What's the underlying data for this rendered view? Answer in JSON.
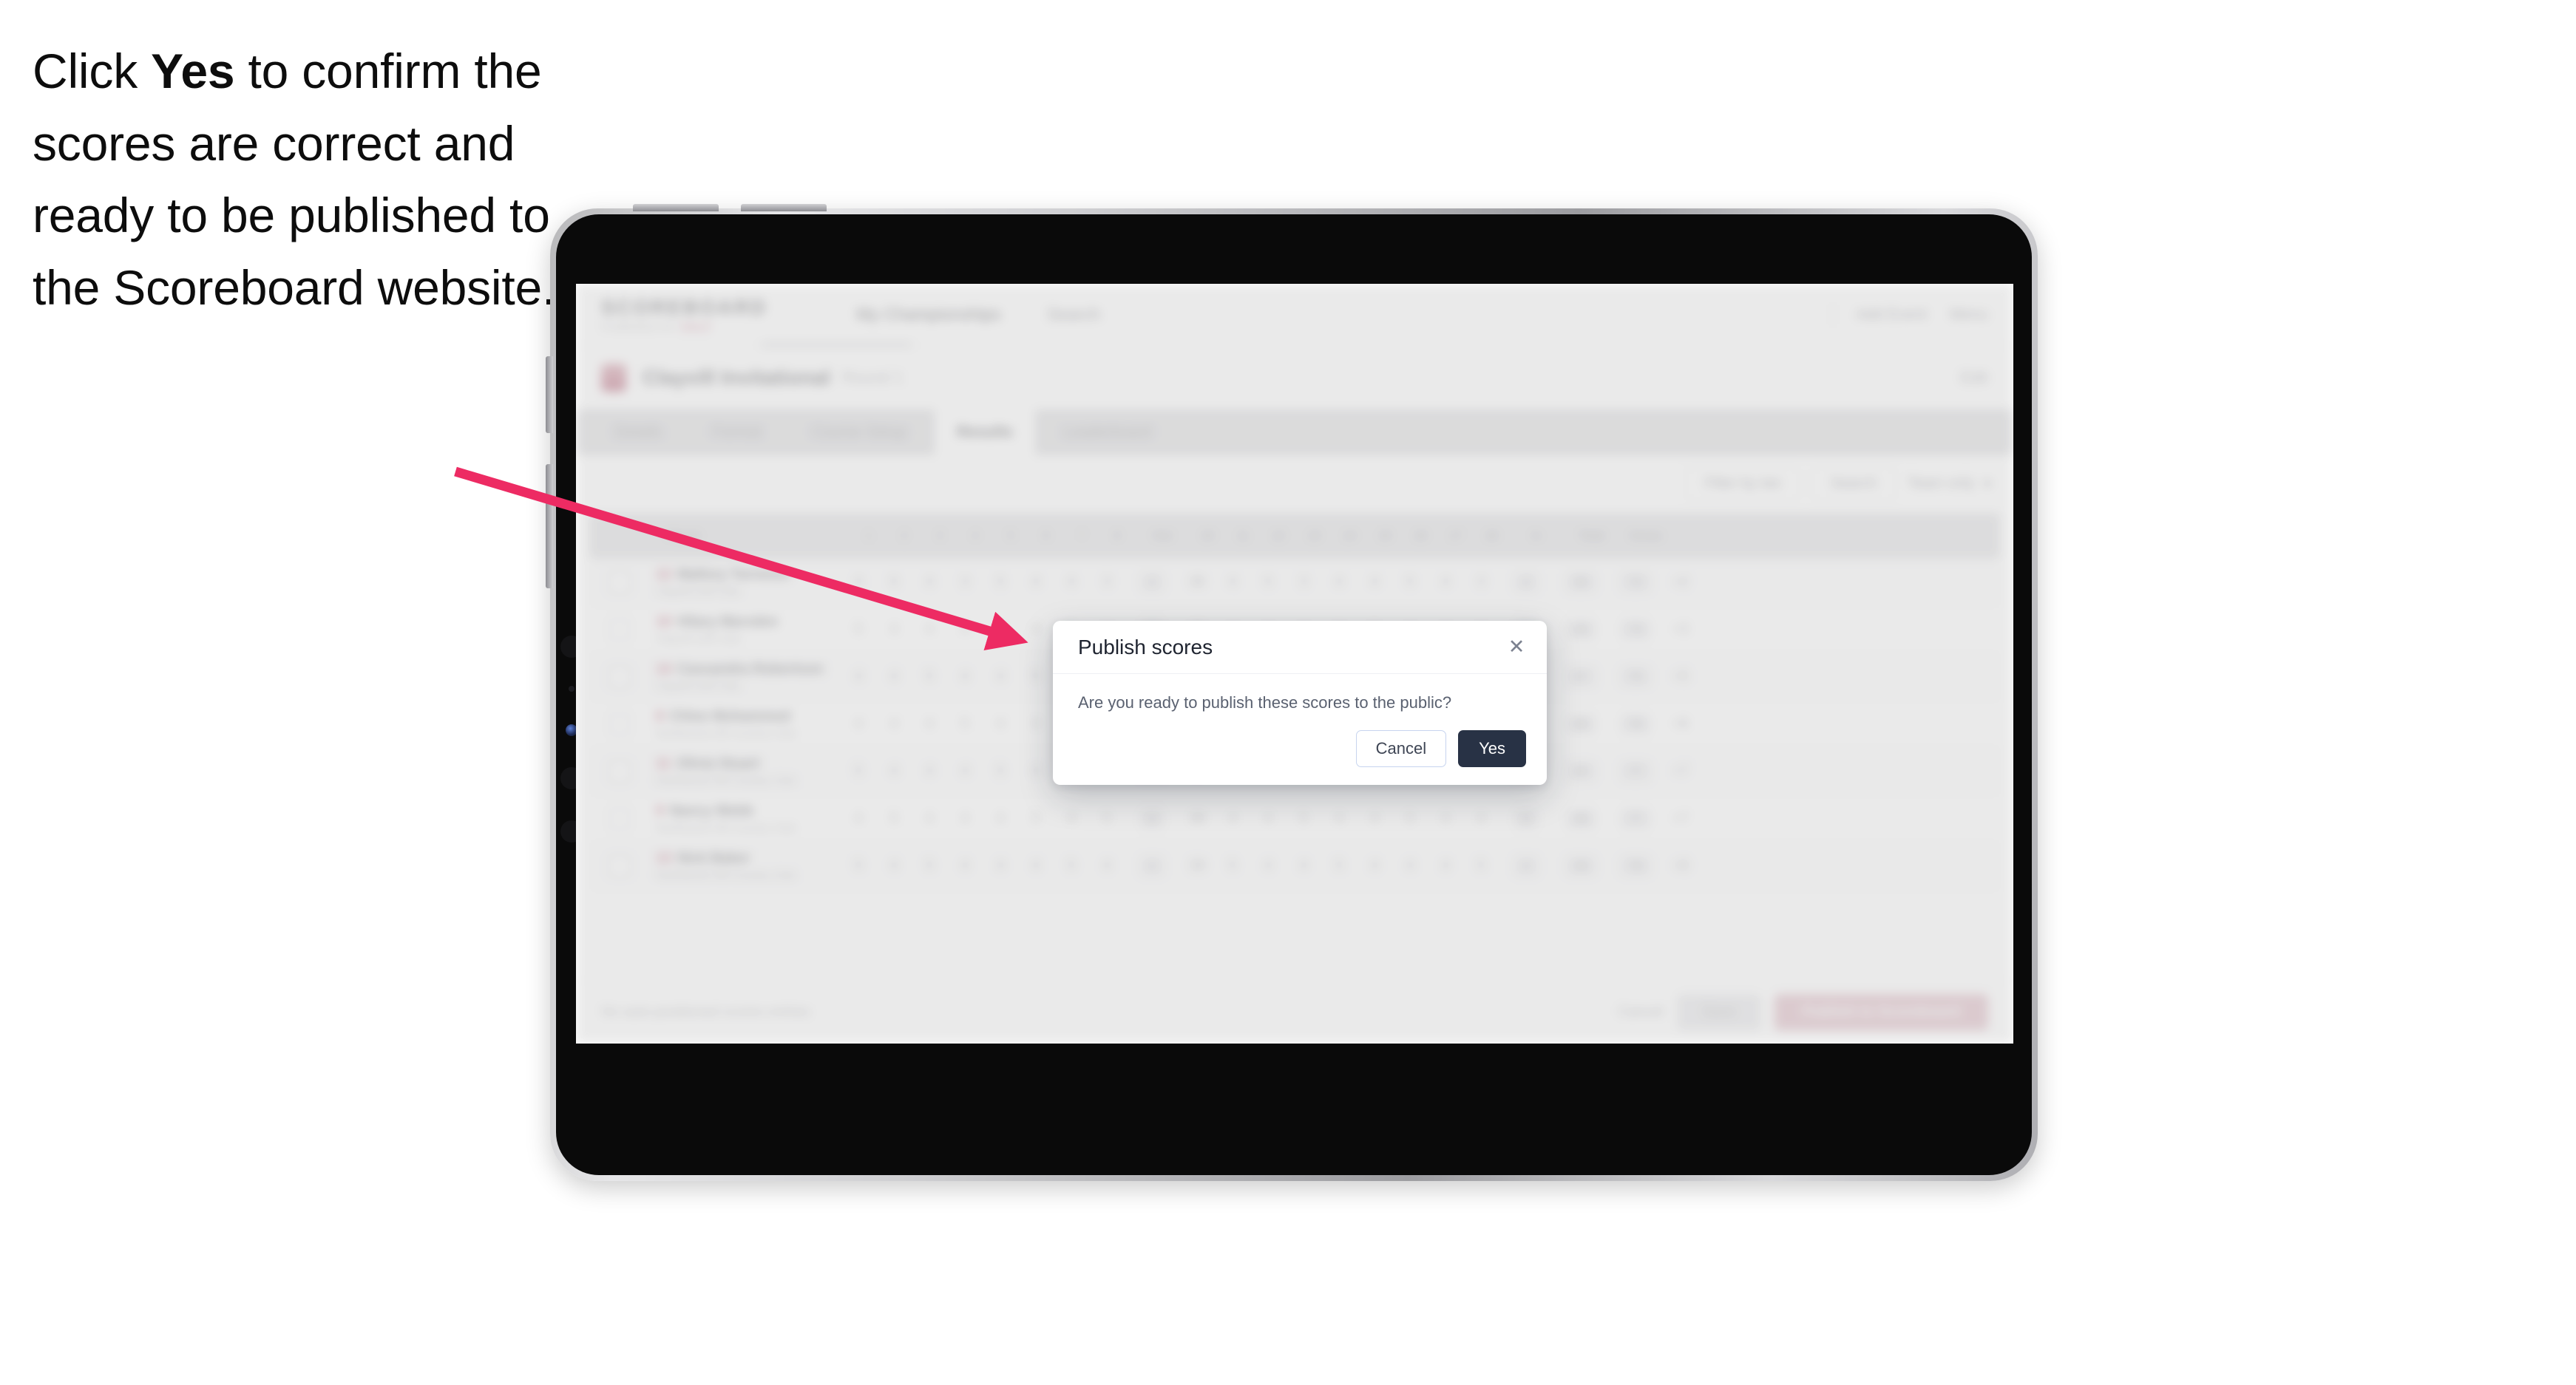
{
  "caption": {
    "before": "Click ",
    "emphasis": "Yes",
    "after": " to confirm the scores are correct and ready to be published to the Scoreboard website."
  },
  "device": {
    "type": "tablet",
    "orientation": "landscape"
  },
  "app": {
    "logo": {
      "main": "SCOREBOARD",
      "sub_prefix": "POWERED BY ",
      "sub_brand": "GOLF"
    },
    "topnav": [
      {
        "label": "My Championships",
        "active": true
      },
      {
        "label": "Search",
        "active": false
      }
    ],
    "topbar_right": [
      {
        "label": "Add Event"
      },
      {
        "label": "Menu"
      }
    ],
    "subheader": {
      "title": "Clayvill Invitational",
      "meta": "Round 1",
      "right": "Edit"
    },
    "tabs": [
      {
        "label": "Details",
        "active": false
      },
      {
        "label": "Format",
        "active": false
      },
      {
        "label": "Course Setup",
        "active": false
      },
      {
        "label": "Results",
        "active": true
      },
      {
        "label": "Leaderboard",
        "active": false
      }
    ],
    "filters": {
      "filter_label": "Filter by tee",
      "search_placeholder": "Search",
      "sort_label": "Team only"
    },
    "table": {
      "columns": [
        "Player",
        "1",
        "2",
        "3",
        "4",
        "5",
        "6",
        "7",
        "8",
        "Out",
        "10",
        "11",
        "12",
        "13",
        "14",
        "15",
        "16",
        "17",
        "18",
        "In",
        "Total",
        "Gross"
      ],
      "rows": [
        {
          "player": "Mallory Torrence",
          "handicap": "12",
          "club": "Clayvill Golf Club",
          "holes": [
            "4",
            "5",
            "4",
            "3",
            "5",
            "4",
            "4",
            "3",
            "4",
            "36",
            "4",
            "5",
            "3",
            "4",
            "4",
            "5",
            "4",
            "3",
            "4",
            "36",
            "72",
            "+2"
          ],
          "out": "36",
          "in": "36",
          "total": "72",
          "gross": "+2"
        },
        {
          "player": "Hilary Marsden",
          "handicap": "10",
          "club": "Clayvill Golf Club",
          "holes": [
            "5",
            "4",
            "4",
            "4",
            "4",
            "4",
            "5",
            "3",
            "4",
            "37",
            "4",
            "4",
            "4",
            "3",
            "5",
            "4",
            "4",
            "4",
            "4",
            "36",
            "73",
            "+3"
          ],
          "out": "37",
          "in": "36",
          "total": "73",
          "gross": "+3"
        },
        {
          "player": "Cassandra Robertson",
          "handicap": "14",
          "club": "Clayvill Golf Club",
          "holes": [
            "4",
            "4",
            "5",
            "4",
            "4",
            "5",
            "4",
            "4",
            "4",
            "38",
            "4",
            "4",
            "5",
            "4",
            "4",
            "4",
            "4",
            "4",
            "4",
            "37",
            "75",
            "+5"
          ],
          "out": "38",
          "in": "37",
          "total": "75",
          "gross": "+5"
        },
        {
          "player": "Chloe Mohammed",
          "handicap": "8",
          "club": "Northwood Hill Country Club",
          "holes": [
            "4",
            "4",
            "4",
            "5",
            "4",
            "4",
            "4",
            "4",
            "5",
            "38",
            "4",
            "5",
            "4",
            "4",
            "4",
            "4",
            "5",
            "4",
            "4",
            "38",
            "76",
            "+6"
          ],
          "out": "38",
          "in": "38",
          "total": "76",
          "gross": "+6"
        },
        {
          "player": "Olivia Stuart",
          "handicap": "11",
          "club": "Northwood Hill Country Club",
          "holes": [
            "5",
            "4",
            "4",
            "4",
            "5",
            "4",
            "4",
            "4",
            "4",
            "38",
            "5",
            "4",
            "4",
            "4",
            "5",
            "4",
            "4",
            "4",
            "5",
            "39",
            "77",
            "+7"
          ],
          "out": "38",
          "in": "39",
          "total": "77",
          "gross": "+7"
        },
        {
          "player": "Nancy Webb",
          "handicap": "9",
          "club": "Northwood Hill Country Club",
          "holes": [
            "4",
            "5",
            "4",
            "4",
            "4",
            "5",
            "4",
            "5",
            "4",
            "39",
            "4",
            "4",
            "5",
            "4",
            "4",
            "5",
            "4",
            "4",
            "4",
            "38",
            "77",
            "+7"
          ],
          "out": "39",
          "in": "38",
          "total": "77",
          "gross": "+7"
        },
        {
          "player": "Nick Baker",
          "handicap": "13",
          "club": "Northwood Hill Country Club",
          "holes": [
            "5",
            "4",
            "5",
            "4",
            "4",
            "4",
            "5",
            "4",
            "4",
            "39",
            "5",
            "4",
            "4",
            "5",
            "4",
            "4",
            "4",
            "5",
            "4",
            "39",
            "78",
            "+8"
          ],
          "out": "39",
          "in": "39",
          "total": "78",
          "gross": "+8"
        }
      ]
    },
    "footer": {
      "note": "No auto-positioned scores entries",
      "link": "Cancel",
      "btn_secondary": "Save",
      "btn_primary": "Publish to Scoreboard"
    }
  },
  "dialog": {
    "title": "Publish scores",
    "close_icon": "close-icon",
    "message": "Are you ready to publish these scores to the public?",
    "cancel_label": "Cancel",
    "confirm_label": "Yes"
  },
  "annotation": {
    "arrow_color": "#ED2B63"
  }
}
